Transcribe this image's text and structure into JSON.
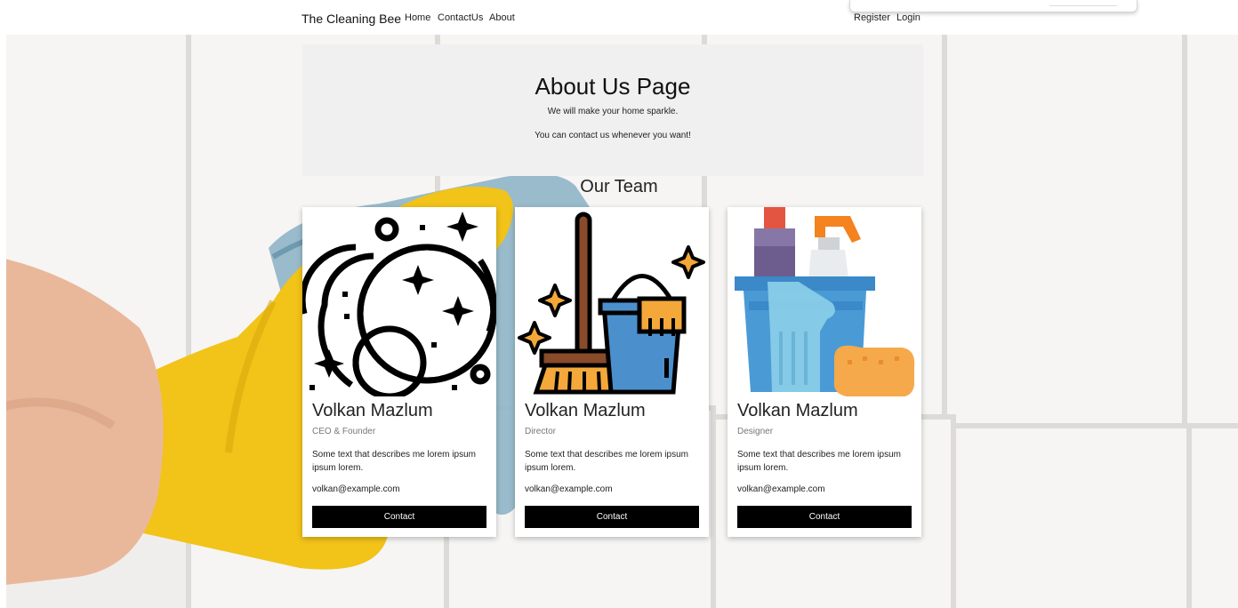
{
  "nav": {
    "brand": "The Cleaning Bee",
    "links": [
      "Home",
      "ContactUs",
      "About"
    ],
    "right_links": [
      "Register",
      "Login"
    ]
  },
  "hero": {
    "title": "About Us Page",
    "line1": "We will make your home sparkle.",
    "line2": "You can contact us whenever you want!"
  },
  "team": {
    "title": "Our Team",
    "members": [
      {
        "name": "Volkan Mazlum",
        "role": "CEO & Founder",
        "description": "Some text that describes me lorem ipsum ipsum lorem.",
        "email": "volkan@example.com",
        "button": "Contact",
        "icon": "bubbles-icon"
      },
      {
        "name": "Volkan Mazlum",
        "role": "Director",
        "description": "Some text that describes me lorem ipsum ipsum lorem.",
        "email": "volkan@example.com",
        "button": "Contact",
        "icon": "broom-bucket-icon"
      },
      {
        "name": "Volkan Mazlum",
        "role": "Designer",
        "description": "Some text that describes me lorem ipsum ipsum lorem.",
        "email": "volkan@example.com",
        "button": "Contact",
        "icon": "cleaning-supplies-icon"
      }
    ]
  },
  "colors": {
    "button_bg": "#000000",
    "jumbotron_bg": "#f0f0f0",
    "glove_yellow": "#f2c318"
  }
}
